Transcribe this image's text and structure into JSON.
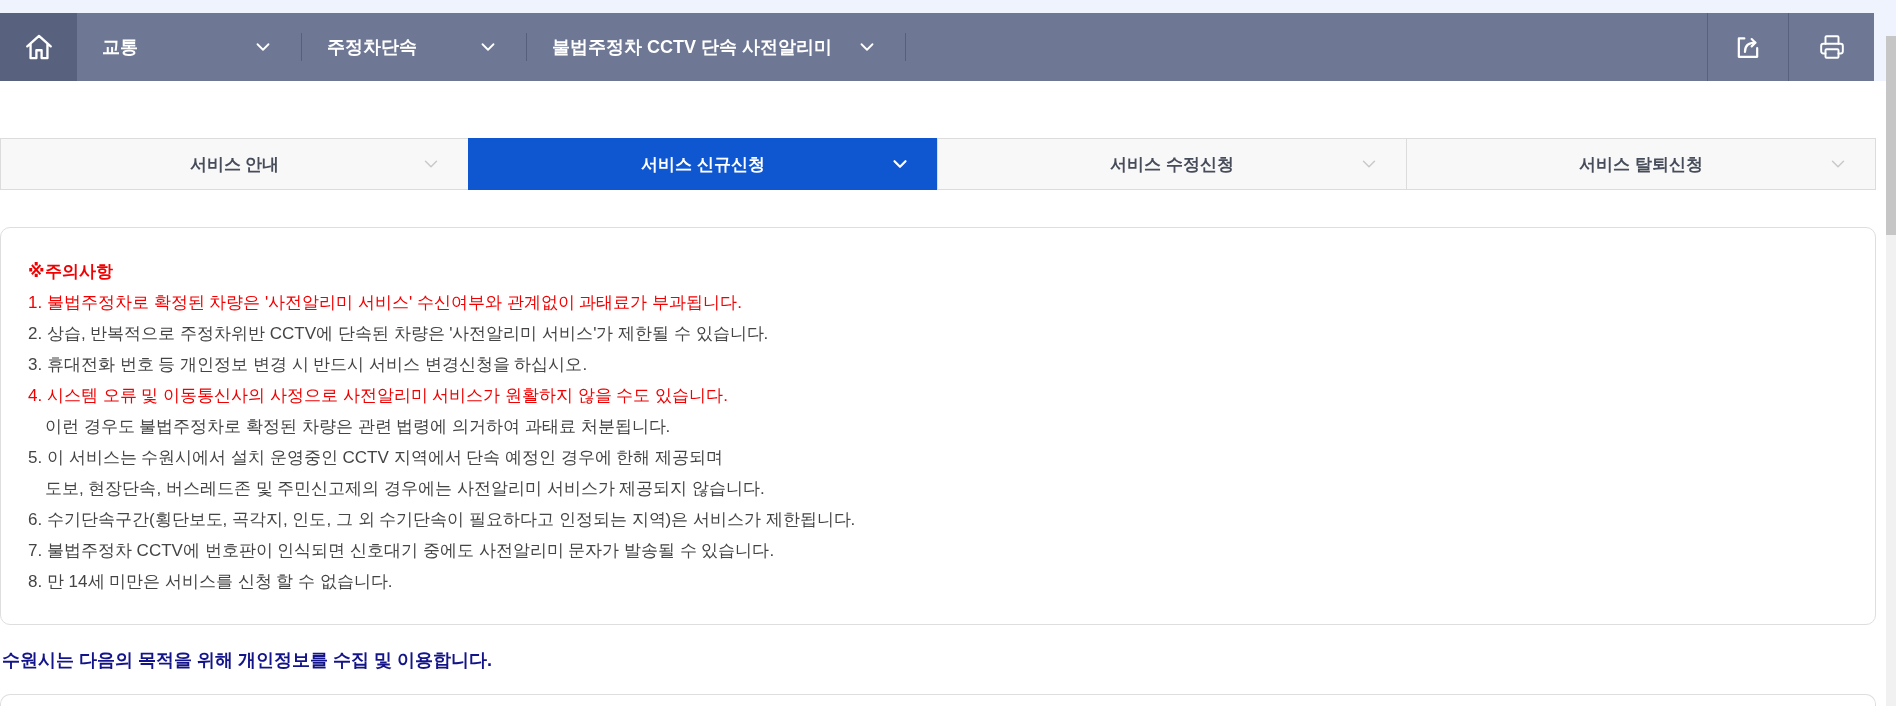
{
  "nav": {
    "breadcrumbs": [
      {
        "label": "교통"
      },
      {
        "label": "주정차단속"
      },
      {
        "label": "불법주정차 CCTV 단속 사전알리미"
      }
    ]
  },
  "tabs": [
    {
      "label": "서비스 안내",
      "selected": false
    },
    {
      "label": "서비스 신규신청",
      "selected": true
    },
    {
      "label": "서비스 수정신청",
      "selected": false
    },
    {
      "label": "서비스 탈퇴신청",
      "selected": false
    }
  ],
  "notice": {
    "title": "※주의사항",
    "lines": [
      {
        "kind": "warning",
        "text": "1. 불법주정차로 확정된 차량은 '사전알리미 서비스' 수신여부와 관계없이 과태료가 부과됩니다."
      },
      {
        "kind": "normal",
        "text": "2. 상습, 반복적으로 주정차위반 CCTV에 단속된 차량은 '사전알리미 서비스'가 제한될 수 있습니다."
      },
      {
        "kind": "normal",
        "text": "3. 휴대전화 번호 등 개인정보 변경 시 반드시 서비스 변경신청을 하십시오."
      },
      {
        "kind": "warning",
        "text": "4. 시스템 오류 및 이동통신사의 사정으로 사전알리미 서비스가 원활하지 않을 수도 있습니다."
      },
      {
        "kind": "indented",
        "text": "이런 경우도 불법주정차로 확정된 차량은 관련 법령에 의거하여 과태료 처분됩니다."
      },
      {
        "kind": "normal",
        "text": "5. 이 서비스는 수원시에서 설치 운영중인 CCTV 지역에서 단속 예정인 경우에 한해 제공되며"
      },
      {
        "kind": "indented",
        "text": "도보, 현장단속, 버스레드존 및 주민신고제의 경우에는 사전알리미 서비스가 제공되지 않습니다."
      },
      {
        "kind": "normal",
        "text": "6. 수기단속구간(횡단보도, 곡각지, 인도, 그 외 수기단속이 필요하다고 인정되는 지역)은 서비스가 제한됩니다."
      },
      {
        "kind": "normal",
        "text": "7. 불법주정차 CCTV에 번호판이 인식되면 신호대기 중에도 사전알리미 문자가 발송될 수 있습니다."
      },
      {
        "kind": "normal",
        "text": "8. 만 14세 미만은 서비스를 신청 할 수 없습니다."
      }
    ]
  },
  "privacy_heading": "수원시는 다음의 목적을 위해 개인정보를 수집 및 이용합니다."
}
